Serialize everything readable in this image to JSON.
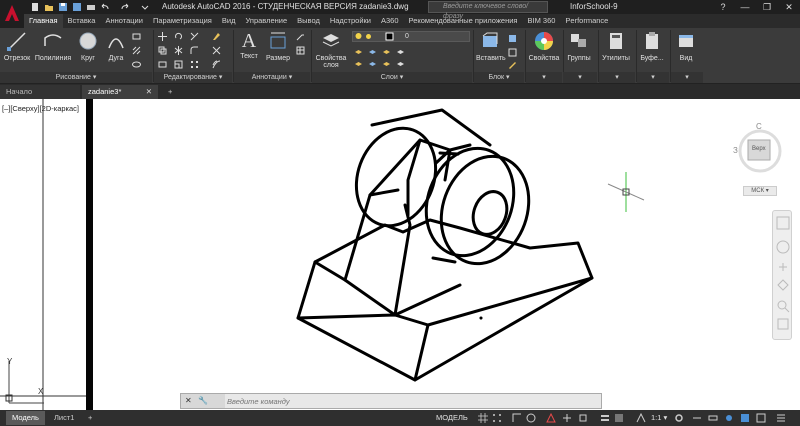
{
  "window": {
    "title": "Autodesk AutoCAD 2016 - СТУДЕНЧЕСКАЯ ВЕРСИЯ    zadanie3.dwg",
    "search_placeholder": "Введите ключевое слово/фразу",
    "user": "InforSchool-9",
    "help": "?",
    "controls": {
      "minimize": "—",
      "restore": "❐",
      "close": "✕"
    }
  },
  "ribbon_tabs": [
    "Главная",
    "Вставка",
    "Аннотации",
    "Параметризация",
    "Вид",
    "Управление",
    "Вывод",
    "Надстройки",
    "A360",
    "Рекомендованные приложения",
    "BIM 360",
    "Performance"
  ],
  "ribbon": {
    "draw": {
      "line": "Отрезок",
      "polyline": "Полилиния",
      "circle": "Круг",
      "arc": "Дуга",
      "footer": "Рисование ▾"
    },
    "modify": {
      "footer": "Редактирование ▾"
    },
    "annotation": {
      "text": "Текст",
      "dimension": "Размер",
      "footer": "Аннотации ▾"
    },
    "layers": {
      "properties": "Свойства",
      "properties2": "слоя",
      "current_layer": "0",
      "footer": "Слои ▾"
    },
    "block": {
      "insert": "Вставить",
      "footer": "Блок ▾"
    },
    "properties": {
      "label": "Свойства"
    },
    "groups": {
      "label": "Группы"
    },
    "utilities": {
      "label": "Утилиты"
    },
    "clipboard": {
      "label": "Буфе..."
    },
    "view": {
      "label": "Вид"
    }
  },
  "file_tabs": {
    "start": "Начало",
    "file": "zadanie3*",
    "add": "+"
  },
  "viewport_label": "[–][Сверху][2D-каркас]",
  "viewcube": {
    "top": "С",
    "west": "З",
    "face": "Верх",
    "ucs": "МСК ▾"
  },
  "ucs_icon": {
    "y": "Y",
    "x": "X"
  },
  "command_line": {
    "placeholder": "Введите команду"
  },
  "layout_tabs": {
    "model": "Модель",
    "sheet": "Лист1",
    "add": "+"
  },
  "status": {
    "mode": "МОДЕЛЬ",
    "scale": "1:1 ▾"
  },
  "colors": {
    "ribbon_bg": "#3b3b3b",
    "title_bg": "#1f1f1f",
    "canvas_bg": "#ffffff",
    "accent_red": "#c8102e"
  }
}
